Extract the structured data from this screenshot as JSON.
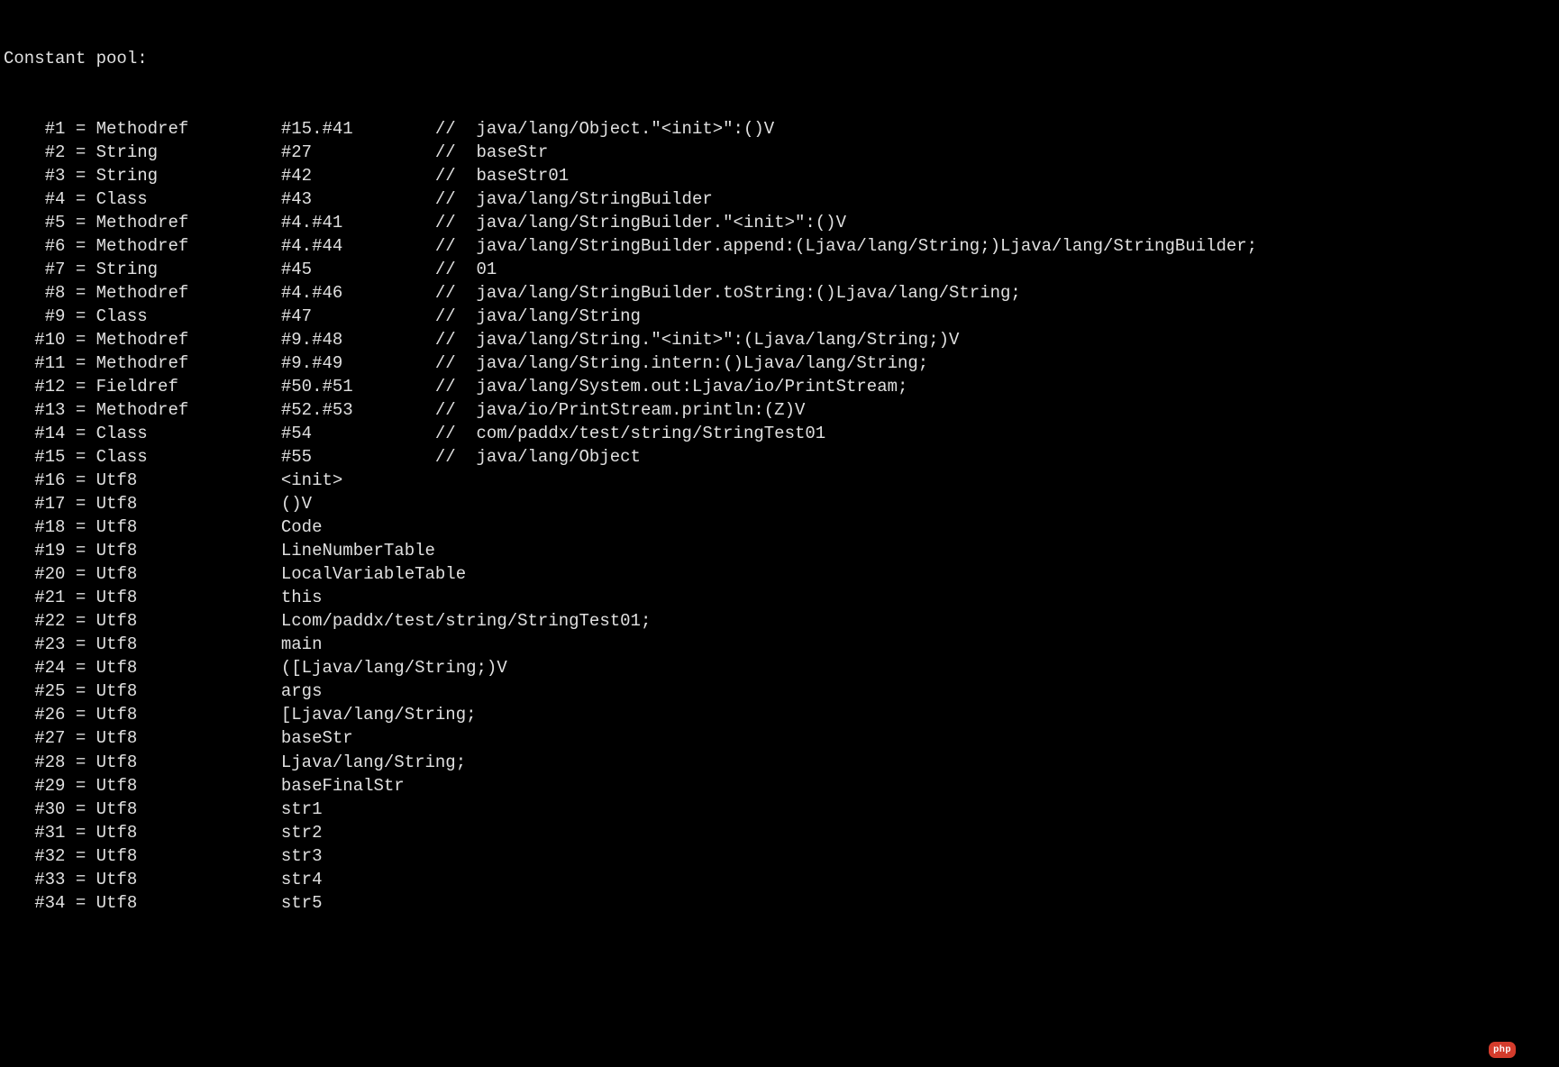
{
  "header": "Constant pool:",
  "entries": [
    {
      "idx": "#1",
      "kind": "Methodref",
      "ref": "#15.#41",
      "comment": "java/lang/Object.\"<init>\":()V"
    },
    {
      "idx": "#2",
      "kind": "String",
      "ref": "#27",
      "comment": "baseStr"
    },
    {
      "idx": "#3",
      "kind": "String",
      "ref": "#42",
      "comment": "baseStr01"
    },
    {
      "idx": "#4",
      "kind": "Class",
      "ref": "#43",
      "comment": "java/lang/StringBuilder"
    },
    {
      "idx": "#5",
      "kind": "Methodref",
      "ref": "#4.#41",
      "comment": "java/lang/StringBuilder.\"<init>\":()V"
    },
    {
      "idx": "#6",
      "kind": "Methodref",
      "ref": "#4.#44",
      "comment": "java/lang/StringBuilder.append:(Ljava/lang/String;)Ljava/lang/StringBuilder;"
    },
    {
      "idx": "#7",
      "kind": "String",
      "ref": "#45",
      "comment": "01"
    },
    {
      "idx": "#8",
      "kind": "Methodref",
      "ref": "#4.#46",
      "comment": "java/lang/StringBuilder.toString:()Ljava/lang/String;"
    },
    {
      "idx": "#9",
      "kind": "Class",
      "ref": "#47",
      "comment": "java/lang/String"
    },
    {
      "idx": "#10",
      "kind": "Methodref",
      "ref": "#9.#48",
      "comment": "java/lang/String.\"<init>\":(Ljava/lang/String;)V"
    },
    {
      "idx": "#11",
      "kind": "Methodref",
      "ref": "#9.#49",
      "comment": "java/lang/String.intern:()Ljava/lang/String;"
    },
    {
      "idx": "#12",
      "kind": "Fieldref",
      "ref": "#50.#51",
      "comment": "java/lang/System.out:Ljava/io/PrintStream;"
    },
    {
      "idx": "#13",
      "kind": "Methodref",
      "ref": "#52.#53",
      "comment": "java/io/PrintStream.println:(Z)V"
    },
    {
      "idx": "#14",
      "kind": "Class",
      "ref": "#54",
      "comment": "com/paddx/test/string/StringTest01"
    },
    {
      "idx": "#15",
      "kind": "Class",
      "ref": "#55",
      "comment": "java/lang/Object"
    },
    {
      "idx": "#16",
      "kind": "Utf8",
      "ref": "<init>",
      "comment": null
    },
    {
      "idx": "#17",
      "kind": "Utf8",
      "ref": "()V",
      "comment": null
    },
    {
      "idx": "#18",
      "kind": "Utf8",
      "ref": "Code",
      "comment": null
    },
    {
      "idx": "#19",
      "kind": "Utf8",
      "ref": "LineNumberTable",
      "comment": null
    },
    {
      "idx": "#20",
      "kind": "Utf8",
      "ref": "LocalVariableTable",
      "comment": null
    },
    {
      "idx": "#21",
      "kind": "Utf8",
      "ref": "this",
      "comment": null
    },
    {
      "idx": "#22",
      "kind": "Utf8",
      "ref": "Lcom/paddx/test/string/StringTest01;",
      "comment": null
    },
    {
      "idx": "#23",
      "kind": "Utf8",
      "ref": "main",
      "comment": null
    },
    {
      "idx": "#24",
      "kind": "Utf8",
      "ref": "([Ljava/lang/String;)V",
      "comment": null
    },
    {
      "idx": "#25",
      "kind": "Utf8",
      "ref": "args",
      "comment": null
    },
    {
      "idx": "#26",
      "kind": "Utf8",
      "ref": "[Ljava/lang/String;",
      "comment": null
    },
    {
      "idx": "#27",
      "kind": "Utf8",
      "ref": "baseStr",
      "comment": null
    },
    {
      "idx": "#28",
      "kind": "Utf8",
      "ref": "Ljava/lang/String;",
      "comment": null
    },
    {
      "idx": "#29",
      "kind": "Utf8",
      "ref": "baseFinalStr",
      "comment": null
    },
    {
      "idx": "#30",
      "kind": "Utf8",
      "ref": "str1",
      "comment": null
    },
    {
      "idx": "#31",
      "kind": "Utf8",
      "ref": "str2",
      "comment": null
    },
    {
      "idx": "#32",
      "kind": "Utf8",
      "ref": "str3",
      "comment": null
    },
    {
      "idx": "#33",
      "kind": "Utf8",
      "ref": "str4",
      "comment": null
    },
    {
      "idx": "#34",
      "kind": "Utf8",
      "ref": "str5",
      "comment": null
    }
  ],
  "columns": {
    "idx_width": 4,
    "kind_col": 20,
    "ref_col": 15,
    "comment_prefix": "//  "
  },
  "watermark": "php"
}
